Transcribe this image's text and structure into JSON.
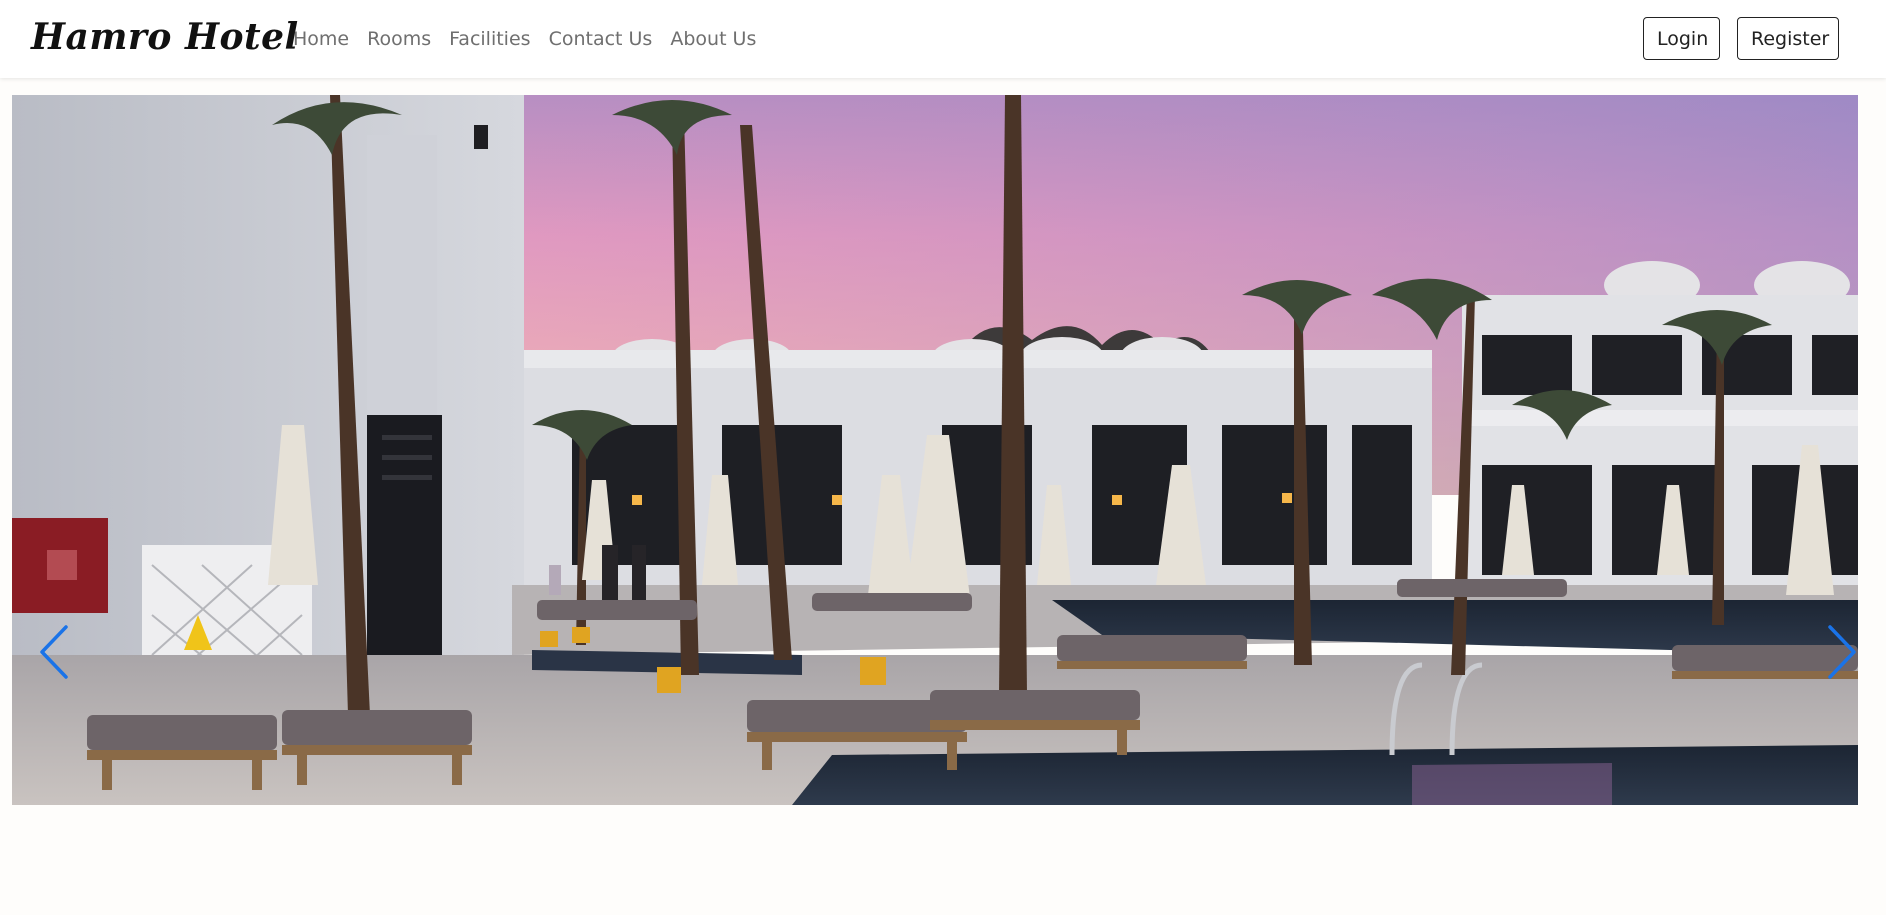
{
  "navbar": {
    "brand": "Hamro Hotel",
    "links": [
      {
        "label": "Home"
      },
      {
        "label": "Rooms"
      },
      {
        "label": "Facilities"
      },
      {
        "label": "Contact Us"
      },
      {
        "label": "About Us"
      }
    ],
    "login_label": "Login",
    "register_label": "Register"
  },
  "carousel": {
    "prev_icon": "chevron-left-icon",
    "next_icon": "chevron-right-icon",
    "arrow_color": "#1a73e8",
    "slide_description_icon": "hotel-pool-photo"
  },
  "colors": {
    "page_background": "#fefdfb",
    "nav_link": "#6f6f6f",
    "button_border": "#222222"
  }
}
